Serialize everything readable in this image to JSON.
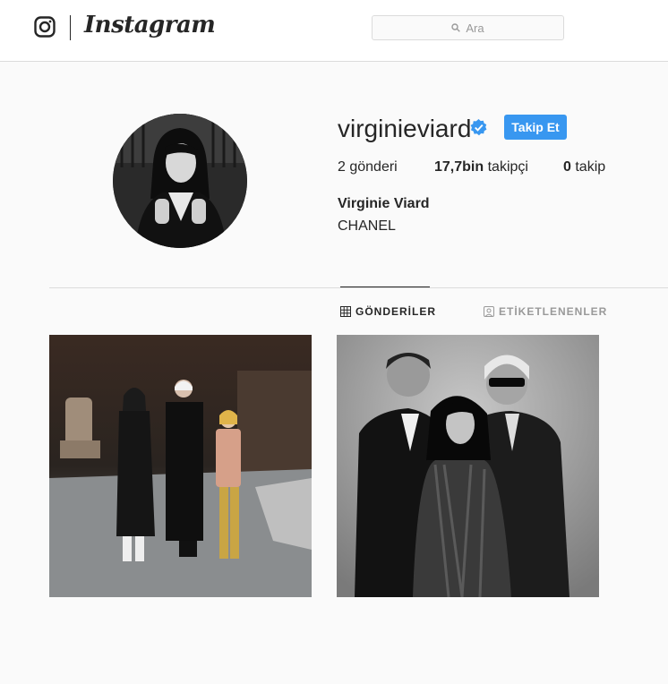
{
  "header": {
    "logo_icon": "instagram-glyph-icon",
    "wordmark": "Instagram",
    "search": {
      "placeholder": "Ara",
      "icon": "search-icon"
    }
  },
  "profile": {
    "username": "virginieviard",
    "verified_icon": "verified-badge-icon",
    "follow_label": "Takip Et",
    "stats": {
      "posts_count": "2",
      "posts_label": "gönderi",
      "followers_count": "17,7bin",
      "followers_label": "takipçi",
      "following_count": "0",
      "following_label": "takip"
    },
    "full_name": "Virginie Viard",
    "bio": "CHANEL"
  },
  "tabs": [
    {
      "label": "GÖNDERİLER",
      "icon": "grid-icon",
      "active": true
    },
    {
      "label": "ETİKETLENENLER",
      "icon": "tagged-icon",
      "active": false
    }
  ],
  "colors": {
    "accent": "#3897f0",
    "border": "#dbdbdb",
    "text": "#262626",
    "muted": "#999999"
  }
}
